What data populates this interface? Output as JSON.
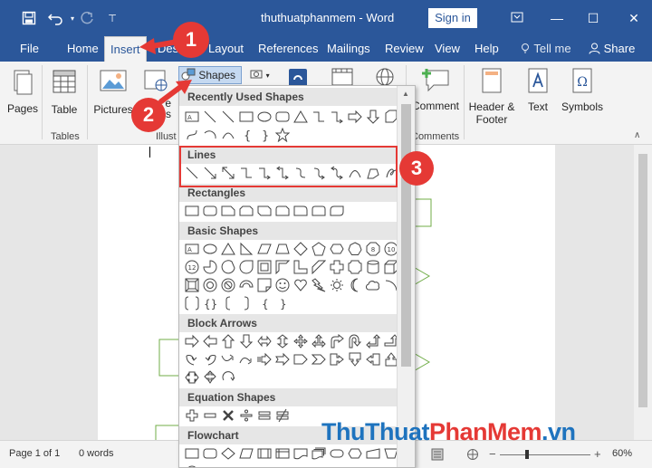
{
  "app": {
    "title": "thuthuatphanmem  -  Word",
    "sign_in_label": "Sign in"
  },
  "tabs": [
    {
      "label": "File"
    },
    {
      "label": "Home"
    },
    {
      "label": "Insert"
    },
    {
      "label": "Desig"
    },
    {
      "label": "Layout"
    },
    {
      "label": "References"
    },
    {
      "label": "Mailings"
    },
    {
      "label": "Review"
    },
    {
      "label": "View"
    },
    {
      "label": "Help"
    },
    {
      "label": "Tell me"
    },
    {
      "label": "Share"
    }
  ],
  "ribbon": {
    "pages_label": "Pages",
    "table_label": "Table",
    "tables_group_label": "Tables",
    "pictures_label": "Pictures",
    "illust_group_label": "Illust",
    "partial_e": "e",
    "partial_es": "es",
    "shapes_label": "Shapes",
    "comment_label": "Comment",
    "comments_group_label": "Comments",
    "header_footer_label_1": "Header &",
    "header_footer_label_2": "Footer",
    "text_label": "Text",
    "symbols_label": "Symbols"
  },
  "shapes_menu": {
    "recently_used": "Recently Used Shapes",
    "lines": "Lines",
    "rectangles": "Rectangles",
    "basic_shapes": "Basic Shapes",
    "block_arrows": "Block Arrows",
    "equation_shapes": "Equation Shapes",
    "flowchart": "Flowchart"
  },
  "callouts": {
    "one": "1",
    "two": "2",
    "three": "3"
  },
  "status": {
    "page": "Page 1 of 1",
    "words": "0 words",
    "zoom": "60%"
  },
  "watermark": {
    "part1": "Thu",
    "part2": "Thuat",
    "part3": "PhanMem",
    "part4": ".vn"
  },
  "colors": {
    "word_blue": "#2b579a",
    "callout_red": "#e53935",
    "doc_shape_green": "#70ad47"
  }
}
